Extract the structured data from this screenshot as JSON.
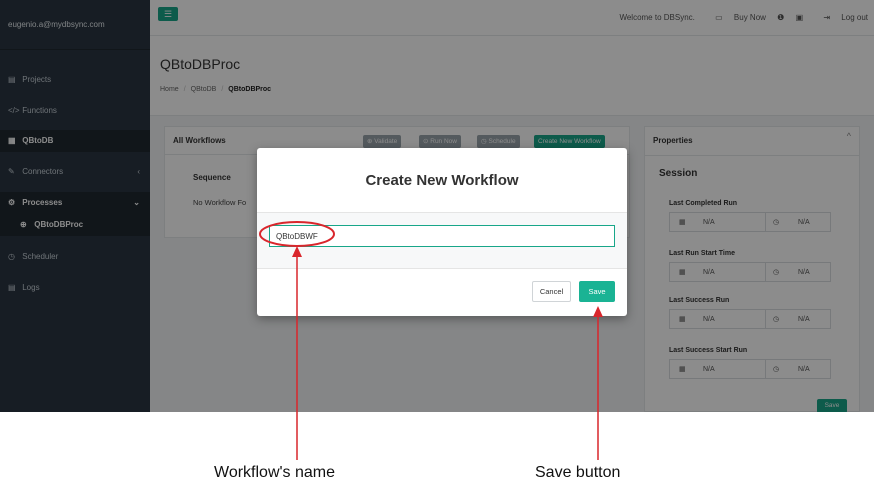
{
  "sidebar": {
    "user": "eugenio.a@mydbsync.com",
    "items": [
      {
        "label": "Projects",
        "icon": "▤"
      },
      {
        "label": "Functions",
        "icon": "</>"
      },
      {
        "label": "QBtoDB",
        "icon": "▦"
      },
      {
        "label": "Connectors",
        "icon": "✎",
        "caret": "‹"
      },
      {
        "label": "Processes",
        "icon": "⚙",
        "caret": "⌄"
      },
      {
        "label": "QBtoDBProc",
        "icon": "⊕"
      },
      {
        "label": "Scheduler",
        "icon": "◷"
      },
      {
        "label": "Logs",
        "icon": "▤"
      }
    ]
  },
  "topbar": {
    "menu_icon": "☰",
    "welcome": "Welcome to DBSync.",
    "buy_now": "Buy Now",
    "buy_icon": "▭",
    "info_icon": "❶",
    "calendar_icon": "▣",
    "logout_icon": "⇥",
    "logout": "Log out"
  },
  "page": {
    "title": "QBtoDBProc",
    "breadcrumb": [
      "Home",
      "QBtoDB",
      "QBtoDBProc"
    ],
    "separator": "/"
  },
  "workflows": {
    "title": "All Workflows",
    "buttons": [
      "⊕ Validate",
      "⊙ Run Now",
      "◷ Schedule",
      "Create New Workflow"
    ],
    "column": "Sequence",
    "empty": "No Workflow Fo"
  },
  "properties": {
    "title": "Properties",
    "chevron": "^",
    "session": "Session",
    "rows": [
      {
        "label": "Last Completed Run",
        "value1": "N/A",
        "value2": "N/A"
      },
      {
        "label": "Last Run Start Time",
        "value1": "N/A",
        "value2": "N/A"
      },
      {
        "label": "Last Success Run",
        "value1": "N/A",
        "value2": "N/A"
      },
      {
        "label": "Last Success Start Run",
        "value1": "N/A",
        "value2": "N/A"
      }
    ],
    "cal_icon": "▦",
    "clock_icon": "◷",
    "save": "Save"
  },
  "modal": {
    "title": "Create New Workflow",
    "input_value": "QBtoDBWF",
    "cancel": "Cancel",
    "save": "Save"
  },
  "annotations": {
    "workflow_name": "Workflow's name",
    "save_button": "Save button",
    "colors": {
      "marker": "#d9262c",
      "accent": "#1ab394"
    }
  }
}
